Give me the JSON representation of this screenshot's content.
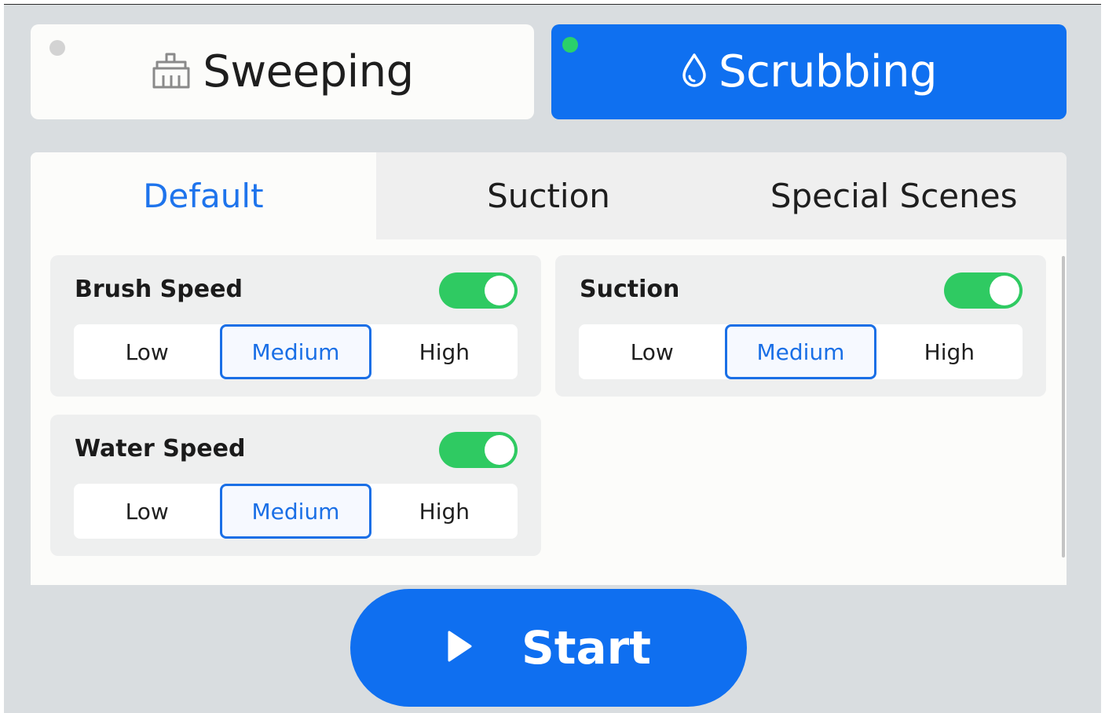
{
  "modes": {
    "sweeping": {
      "label": "Sweeping",
      "icon": "broom-icon",
      "active": false
    },
    "scrubbing": {
      "label": "Scrubbing",
      "icon": "water-drop-icon",
      "active": true
    }
  },
  "tabs": [
    {
      "label": "Default",
      "active": true
    },
    {
      "label": "Suction",
      "active": false
    },
    {
      "label": "Special Scenes",
      "active": false
    }
  ],
  "settings": {
    "brush_speed": {
      "title": "Brush Speed",
      "enabled": true,
      "options": [
        "Low",
        "Medium",
        "High"
      ],
      "selected": "Medium"
    },
    "suction": {
      "title": "Suction",
      "enabled": true,
      "options": [
        "Low",
        "Medium",
        "High"
      ],
      "selected": "Medium"
    },
    "water_speed": {
      "title": "Water Speed",
      "enabled": true,
      "options": [
        "Low",
        "Medium",
        "High"
      ],
      "selected": "Medium"
    }
  },
  "start": {
    "label": "Start",
    "icon": "play-icon"
  },
  "colors": {
    "accent": "#0f70f0",
    "toggle_on": "#2fca62",
    "active_dot": "#2ad16b",
    "inactive_dot": "#d3d3d3"
  }
}
